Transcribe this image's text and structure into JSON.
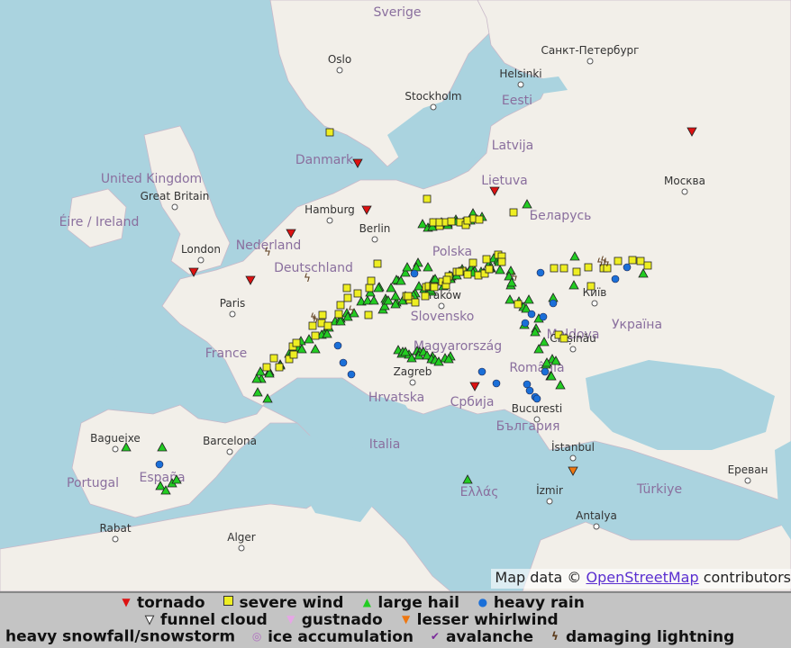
{
  "map": {
    "country_labels": [
      "Sverige",
      "Danmark",
      "Eesti",
      "Latvija",
      "Lietuva",
      "Беларусь",
      "Polska",
      "Deutschland",
      "Nederland",
      "United Kingdom",
      "Éire / Ireland",
      "France",
      "España",
      "Portugal",
      "Italia",
      "Hrvatska",
      "Србија",
      "România",
      "България",
      "Україна",
      "Ελλάς",
      "Türkiye",
      "Slovensko",
      "Magyarország",
      "Moldova"
    ],
    "city_labels": [
      "Oslo",
      "Stockholm",
      "Helsinki",
      "Санкт-Петербург",
      "Москва",
      "Hamburg",
      "Berlin",
      "London",
      "Paris",
      "Barcelona",
      "Zagreb",
      "Bucuresti",
      "İstanbul",
      "İzmir",
      "Antalya",
      "Київ",
      "Chișinău",
      "Baguеixe",
      "Rabat",
      "Alger",
      "Great Britain",
      "Ереван",
      "Kraków"
    ],
    "marker_types": [
      "tornado",
      "severe wind",
      "large hail",
      "heavy rain",
      "funnel cloud",
      "gustnado",
      "lesser whirlwind",
      "heavy snowfall/snowstorm",
      "ice accumulation",
      "avalanche",
      "damaging lightning"
    ]
  },
  "attribution": {
    "prefix": "Map data ©",
    "link": "OpenStreetMap",
    "suffix": "contributors"
  },
  "legend": {
    "row1": [
      "tornado",
      "severe wind",
      "large hail",
      "heavy rain"
    ],
    "row2": [
      "funnel cloud",
      "gustnado",
      "lesser whirlwind"
    ],
    "row3": [
      "heavy snowfall/snowstorm",
      "ice accumulation",
      "avalanche",
      "damaging lightning"
    ]
  },
  "colors": {
    "sea": "#aad3df",
    "land": "#f2efe9",
    "tornado": "#dd1111",
    "severe_wind": "#eeee22",
    "large_hail": "#22cc22",
    "heavy_rain": "#1a6fd8",
    "lesser_whirlwind": "#ee7711",
    "avalanche": "#7a2a9a",
    "legend_bg": "#c4c4c4"
  }
}
